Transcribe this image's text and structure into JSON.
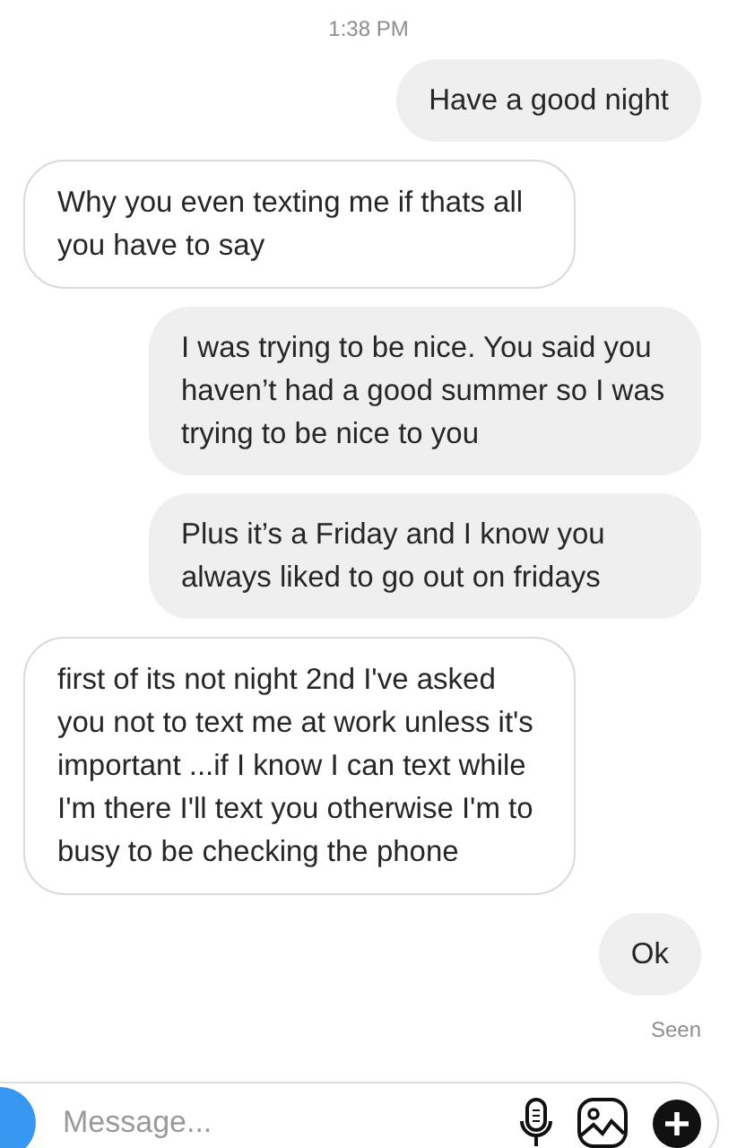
{
  "timestamp": "1:38 PM",
  "messages": [
    {
      "kind": "sent",
      "text": "Have a good night"
    },
    {
      "kind": "received",
      "text": "Why you even texting me if thats all you have to say"
    },
    {
      "kind": "sent",
      "text": "I was trying to be nice. You said you haven’t had a good summer so I was trying to be nice to you"
    },
    {
      "kind": "sent",
      "text": "Plus it’s a Friday and I know you always liked to go out on fridays"
    },
    {
      "kind": "received",
      "text": "first of its not night 2nd I've asked you not to text me at work unless it's important ...if I know I can text while I'm there I'll text you otherwise I'm to busy to be checking the phone"
    },
    {
      "kind": "sent",
      "text": "Ok"
    }
  ],
  "read_receipt": "Seen",
  "composer": {
    "placeholder": "Message..."
  }
}
